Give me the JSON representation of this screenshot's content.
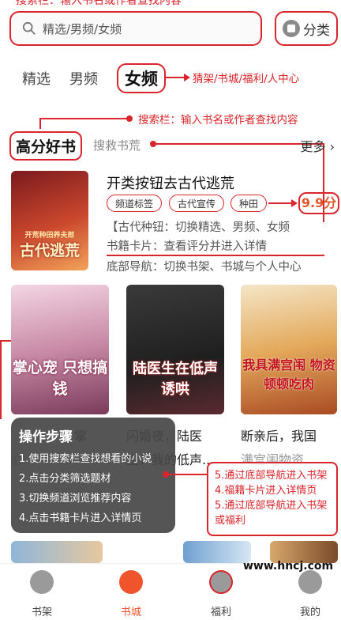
{
  "top_note": "搜索栏：输入书名或作者查找内容",
  "search": {
    "placeholder": "精选/男频/女频"
  },
  "category_button": "分类",
  "tabs": [
    "精选",
    "男频",
    "女频"
  ],
  "notes": {
    "tab_note": "猜架/书城/福利/人中心",
    "search_note": "搜索栏：输入书名或作者查找内容"
  },
  "section": {
    "title": "高分好书",
    "subtitle": "搜救书荒",
    "more": "更多 ›"
  },
  "featured": {
    "cover_text": "古代逃荒",
    "cover_top": "开荒种田养夫郎",
    "title": "开类按钮去古代逃荒",
    "tags": [
      "频道标签",
      "古代宣传",
      "种田"
    ],
    "rating": "9.9分",
    "desc1": "【古代种钮：切换精选、男频、女频",
    "desc2": "书籍卡片：查看评分并进入详情",
    "desc3": "底部导航：切换书架、书城与个人中心"
  },
  "books": [
    {
      "cover": "掌心宠 只想搞钱",
      "name": "掌",
      "sub": "心"
    },
    {
      "cover": "陆医生在低声诱哄",
      "name": "闪婚夜，陆医",
      "sub": "生，我的低声..."
    },
    {
      "cover": "我具满宫闱 物资顿顿吃肉",
      "name": "断亲后，我国",
      "sub": "满宫闱物资..."
    }
  ],
  "steps": {
    "heading": "操作步骤",
    "items": [
      "1.使用搜索栏查找想看的小说",
      "2.点击分类筛选题材",
      "3.切换频道浏览推荐内容",
      "4.点击书籍卡片进入详情页"
    ]
  },
  "right_box": [
    "5.通过底部导航进入书架",
    "4.福籍卡片进入详情页",
    "5.通过底部导航进入书架或福利"
  ],
  "bottom_nav": [
    "书架",
    "书城",
    "福利",
    "我的"
  ],
  "watermark": "www.hncj.com"
}
